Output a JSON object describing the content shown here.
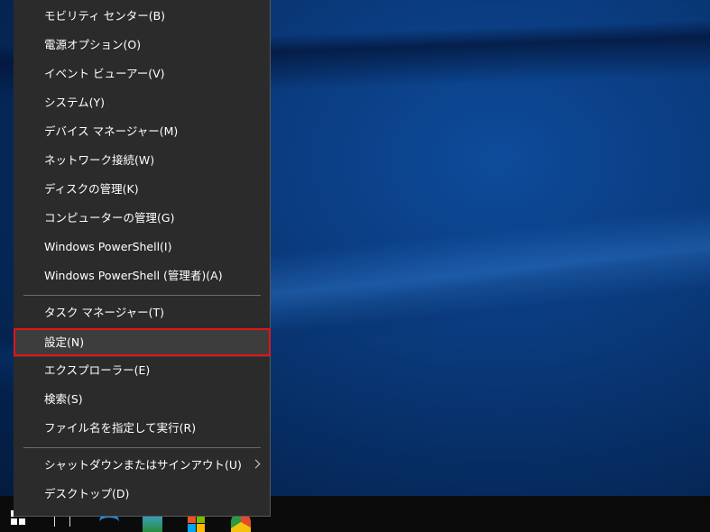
{
  "context_menu": {
    "items": [
      {
        "label": "モビリティ センター(B)"
      },
      {
        "label": "電源オプション(O)"
      },
      {
        "label": "イベント ビューアー(V)"
      },
      {
        "label": "システム(Y)"
      },
      {
        "label": "デバイス マネージャー(M)"
      },
      {
        "label": "ネットワーク接続(W)"
      },
      {
        "label": "ディスクの管理(K)"
      },
      {
        "label": "コンピューターの管理(G)"
      },
      {
        "label": "Windows PowerShell(I)"
      },
      {
        "label": "Windows PowerShell (管理者)(A)"
      },
      {
        "label": "タスク マネージャー(T)"
      },
      {
        "label": "設定(N)"
      },
      {
        "label": "エクスプローラー(E)"
      },
      {
        "label": "検索(S)"
      },
      {
        "label": "ファイル名を指定して実行(R)"
      },
      {
        "label": "シャットダウンまたはサインアウト(U)"
      },
      {
        "label": "デスクトップ(D)"
      }
    ],
    "selected": "設定(N)",
    "highlight_color": "#e3141a"
  },
  "taskbar": {
    "icons": [
      "windows-start-icon",
      "task-view-icon",
      "edge-icon",
      "photos-icon",
      "store-icon",
      "chrome-icon"
    ]
  }
}
